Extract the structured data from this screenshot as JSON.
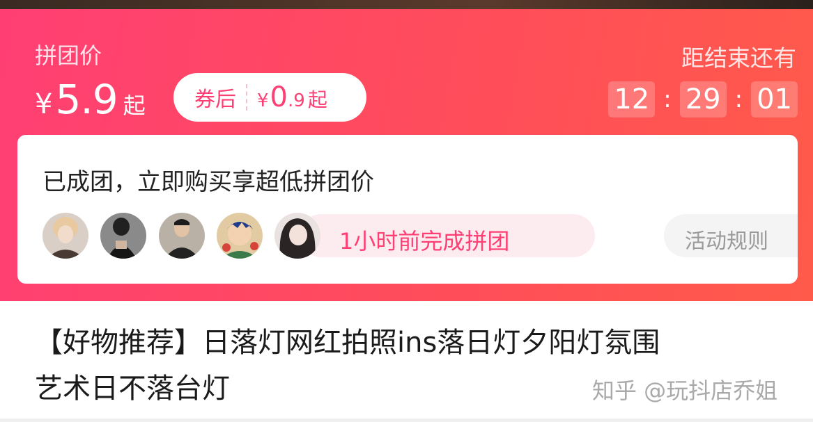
{
  "banner": {
    "group_price_label": "拼团价",
    "price": {
      "currency": "¥",
      "amount": "5.9",
      "suffix": "起"
    },
    "coupon": {
      "label": "券后",
      "currency": "¥",
      "integer": "0",
      "decimal": ".9",
      "suffix": "起"
    },
    "countdown_label": "距结束还有",
    "countdown": {
      "hours": "12",
      "minutes": "29",
      "seconds": "01",
      "separator": ":"
    }
  },
  "group_card": {
    "title": "已成团，立即购买享超低拼团价",
    "avatars": [
      "avatar-1",
      "avatar-2",
      "avatar-3",
      "avatar-4",
      "avatar-5"
    ],
    "completed_text": "1小时前完成拼团",
    "rules_label": "活动规则"
  },
  "product": {
    "title_line1": "【好物推荐】日落灯网红拍照ins落日灯夕阳灯氛围",
    "title_line2": "艺术日不落台灯"
  },
  "watermark": "知乎 @玩抖店乔姐",
  "colors": {
    "accent": "#ff3f74",
    "banner_end": "#ff5a4a",
    "pill_bg": "#fdecef"
  }
}
